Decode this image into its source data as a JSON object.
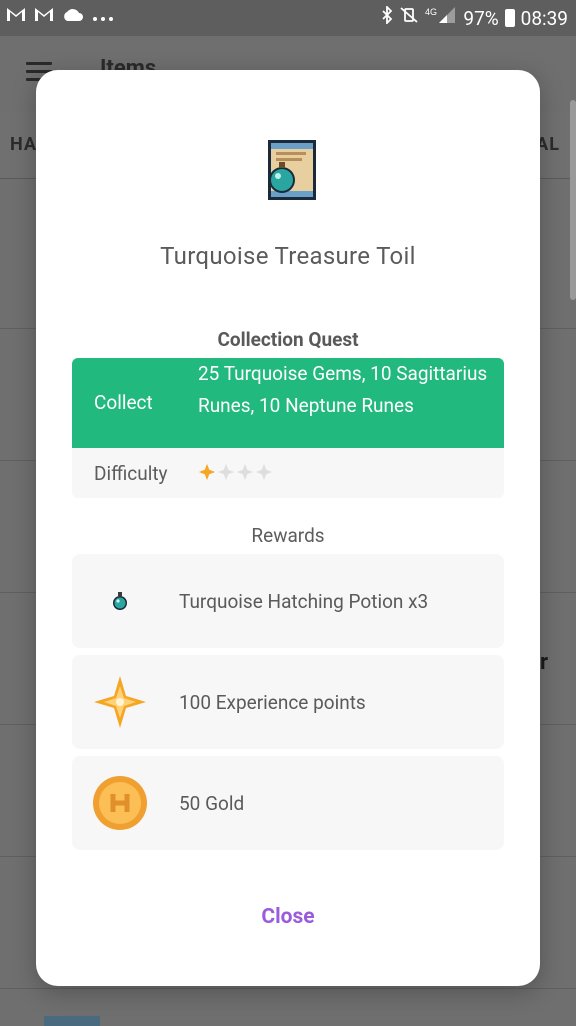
{
  "status_bar": {
    "left_icons": [
      "gmail-icon",
      "gmail-icon",
      "cloud-icon",
      "more-dots-icon"
    ],
    "right_icons": [
      "bluetooth-icon",
      "vibrate-mute-icon",
      "4g-signal-icon"
    ],
    "network": "4G",
    "battery_percent": "97%",
    "time": "08:39"
  },
  "background_app": {
    "title": "Items",
    "tab_left": "HA",
    "tab_right": "AL",
    "side_letter": "r"
  },
  "dialog": {
    "quest_icon": "scroll-with-turquoise-gem-icon",
    "title": "Turquoise Treasure Toil",
    "section_title": "Collection Quest",
    "collect_label": "Collect",
    "collect_value": "25 Turquoise Gems, 10 Sagittarius Runes, 10 Neptune Runes",
    "difficulty_label": "Difficulty",
    "difficulty": 1,
    "difficulty_max": 4,
    "rewards_title": "Rewards",
    "rewards": [
      {
        "icon": "turquoise-hatching-potion-icon",
        "label": "Turquoise Hatching Potion x3"
      },
      {
        "icon": "experience-star-icon",
        "label": "100 Experience points"
      },
      {
        "icon": "gold-coin-icon",
        "label": "50 Gold"
      }
    ],
    "close_label": "Close"
  },
  "colors": {
    "accent_green": "#22b97e",
    "close_purple": "#9a5bdc",
    "star_orange": "#f5a623",
    "overlay": "#6f6f6f"
  }
}
